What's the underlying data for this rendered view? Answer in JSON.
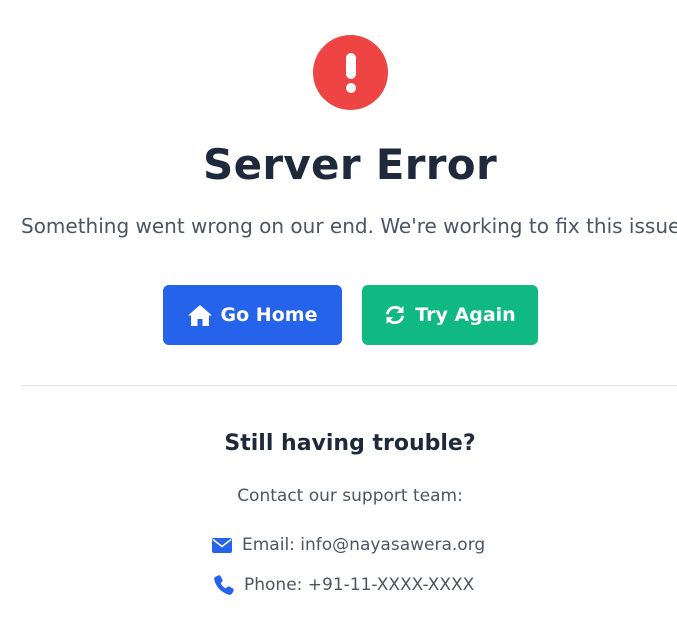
{
  "error": {
    "icon": "exclamation-icon",
    "title": "Server Error",
    "message": "Something went wrong on our end. We're working to fix this issue."
  },
  "actions": {
    "home": {
      "label": "Go Home",
      "icon": "home-icon"
    },
    "retry": {
      "label": "Try Again",
      "icon": "refresh-icon"
    }
  },
  "support": {
    "heading": "Still having trouble?",
    "contact_text": "Contact our support team:",
    "email": {
      "icon": "envelope-icon",
      "text": "Email: info@nayasawera.org"
    },
    "phone": {
      "icon": "phone-icon",
      "text": "Phone: +91-11-XXXX-XXXX"
    }
  },
  "colors": {
    "error_red": "#ef4444",
    "primary_blue": "#2563eb",
    "success_green": "#10b981",
    "heading": "#1e293b",
    "body_text": "#4b5563",
    "divider": "#e5e7eb"
  }
}
